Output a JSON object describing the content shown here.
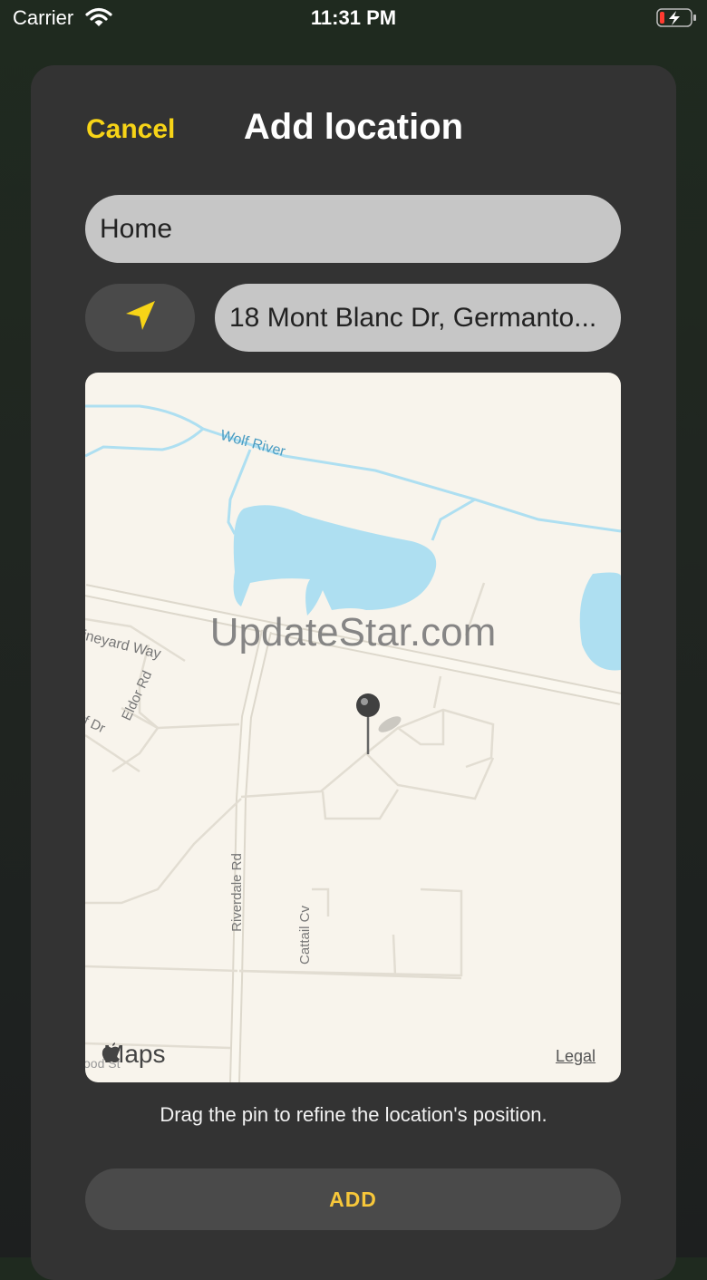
{
  "status_bar": {
    "carrier": "Carrier",
    "time": "11:31 PM"
  },
  "header": {
    "cancel_label": "Cancel",
    "title": "Add location"
  },
  "form": {
    "name_value": "Home",
    "address_value": "18 Mont Blanc Dr, Germanto..."
  },
  "map": {
    "watermark": "UpdateStar.com",
    "brand": "Maps",
    "legal_label": "Legal",
    "labels": {
      "wolf_river": "Wolf River",
      "vineyard_way": "ineyard Way",
      "eldor_rd": "Eldor Rd",
      "f_dr": "f Dr",
      "riverdale_rd": "Riverdale Rd",
      "cattail_cv": "Cattail Cv",
      "wood_st": "ood St"
    }
  },
  "hint": "Drag the pin to refine the location's position.",
  "add_label": "ADD",
  "colors": {
    "accent": "#f7d417",
    "sheet": "#333333",
    "field": "#c6c6c6"
  },
  "icons": [
    "wifi-icon",
    "battery-icon",
    "location-arrow-icon",
    "map-pin-icon",
    "apple-logo-icon"
  ]
}
